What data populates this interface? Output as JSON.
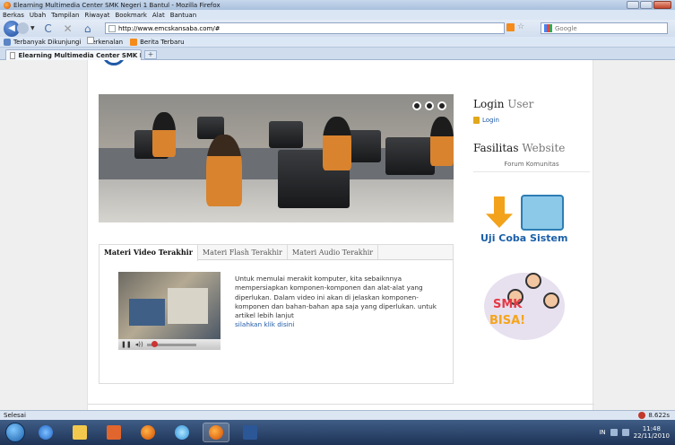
{
  "window": {
    "title": "Elearning Multimedia Center SMK Negeri 1 Bantul - Mozilla Firefox"
  },
  "menu": [
    "Berkas",
    "Ubah",
    "Tampilan",
    "Riwayat",
    "Bookmark",
    "Alat",
    "Bantuan"
  ],
  "nav": {
    "url": "http://www.emcskansaba.com/#",
    "search_placeholder": "Google"
  },
  "bookmarks": [
    {
      "label": "Terbanyak Dikunjungi",
      "icon": "blue"
    },
    {
      "label": "Perkenalan",
      "icon": "page"
    },
    {
      "label": "Berita Terbaru",
      "icon": "rss"
    }
  ],
  "tab": {
    "label": "Elearning Multimedia Center SMK Ne...",
    "new_tab": "+"
  },
  "main": {
    "media_tabs": [
      "Materi Video Terakhir",
      "Materi Flash Terakhir",
      "Materi Audio Terakhir"
    ],
    "video_description": "Untuk memulai merakit komputer, kita sebaiknnya mempersiapkan komponen-komponen dan alat-alat yang diperlukan. Dalam video ini akan di jelaskan komponen-komponen dan bahan-bahan apa saja yang diperlukan. untuk artikel lebih lanjut",
    "video_link": "silahkan klik disini"
  },
  "sidebar": {
    "login_title_1": "Login",
    "login_title_2": "User",
    "login_link": "Login",
    "fasilitas_title_1": "Fasilitas",
    "fasilitas_title_2": "Website",
    "forum_link": "Forum Komunitas",
    "uji_coba": "Uji Coba Sistem",
    "smk_1": "SMK",
    "smk_2": "BISA!"
  },
  "status": {
    "text": "Selesai",
    "speed": "8.622s"
  },
  "taskbar": {
    "time": "11:48",
    "date": "22/11/2010",
    "lang": "IN"
  }
}
